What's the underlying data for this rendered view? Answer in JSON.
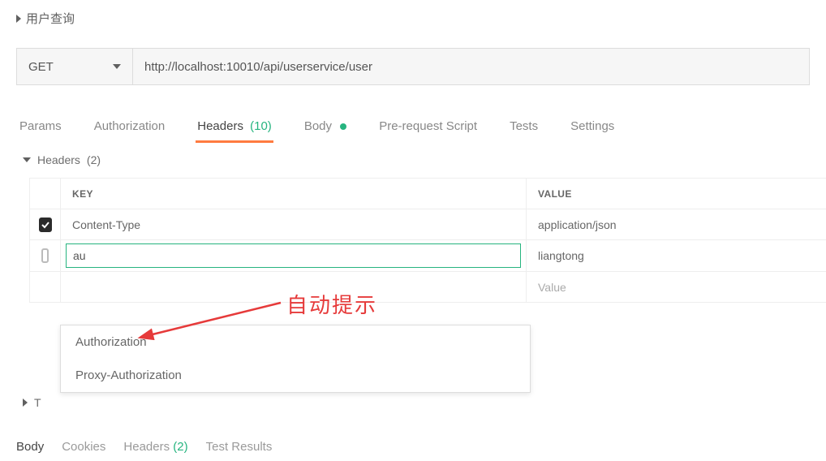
{
  "top_section": {
    "title": "用户查询"
  },
  "request": {
    "method": "GET",
    "url": "http://localhost:10010/api/userservice/user"
  },
  "tabs": {
    "params": "Params",
    "authorization": "Authorization",
    "headers_label": "Headers",
    "headers_count": "(10)",
    "body": "Body",
    "prerequest": "Pre-request Script",
    "tests": "Tests",
    "settings": "Settings"
  },
  "subheader": {
    "label": "Headers",
    "count": "(2)"
  },
  "table": {
    "col_key": "KEY",
    "col_value": "VALUE",
    "row1": {
      "key": "Content-Type",
      "value": "application/json"
    },
    "row2": {
      "key_input": "au",
      "value": "liangtong"
    },
    "row3": {
      "value_placeholder": "Value"
    }
  },
  "autocomplete": {
    "item1": "Authorization",
    "item2": "Proxy-Authorization"
  },
  "t_row_label": "T",
  "bottom": {
    "body": "Body",
    "cookies": "Cookies",
    "headers_label": "Headers",
    "headers_count": "(2)",
    "test_results": "Test Results"
  },
  "annotation": "自动提示"
}
